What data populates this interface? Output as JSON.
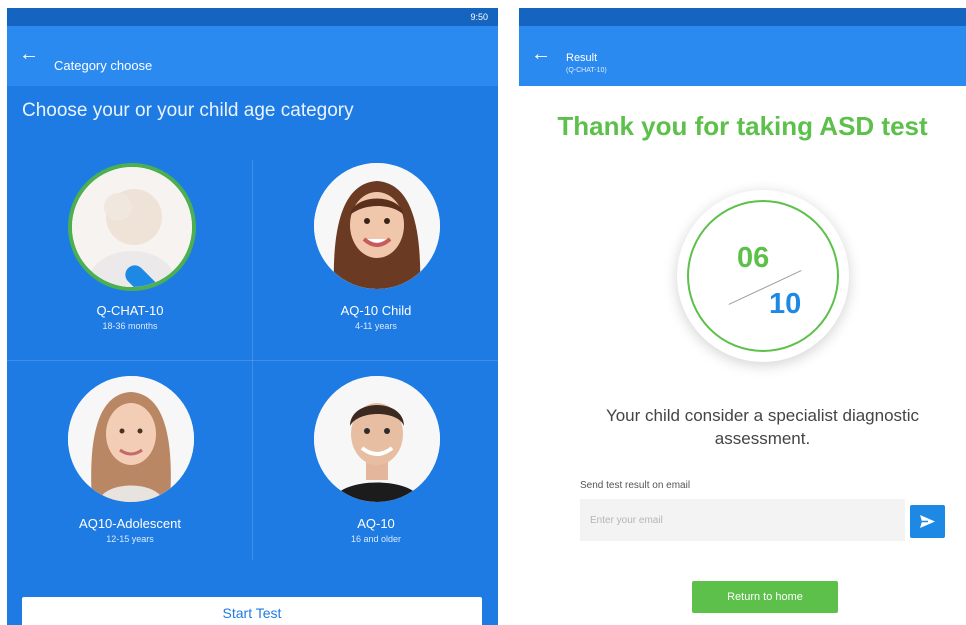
{
  "left_screen": {
    "status_time": "9:50",
    "title": "Category choose",
    "heading": "Choose your or your child age category",
    "categories": [
      {
        "label": "Q-CHAT-10",
        "range": "18-36 months",
        "selected": true
      },
      {
        "label": "AQ-10 Child",
        "range": "4-11 years",
        "selected": false
      },
      {
        "label": "AQ10-Adolescent",
        "range": "12-15 years",
        "selected": false
      },
      {
        "label": "AQ-10",
        "range": "16 and older",
        "selected": false
      }
    ],
    "start_button": "Start Test"
  },
  "right_screen": {
    "title": "Result",
    "subtitle": "(Q-CHAT-10)",
    "thanks": "Thank you for taking ASD test",
    "score": "06",
    "total": "10",
    "message": "Your child consider a specialist diagnostic assessment.",
    "email_label": "Send test result on email",
    "email_placeholder": "Enter your email",
    "email_value": "",
    "home_button": "Return to home"
  },
  "colors": {
    "primary_blue": "#1e7be4",
    "appbar_blue": "#2b8af0",
    "accent_green": "#5cc04a",
    "check_blue": "#1e88e5"
  },
  "icons": [
    "back-arrow-icon",
    "check-icon",
    "send-icon"
  ]
}
